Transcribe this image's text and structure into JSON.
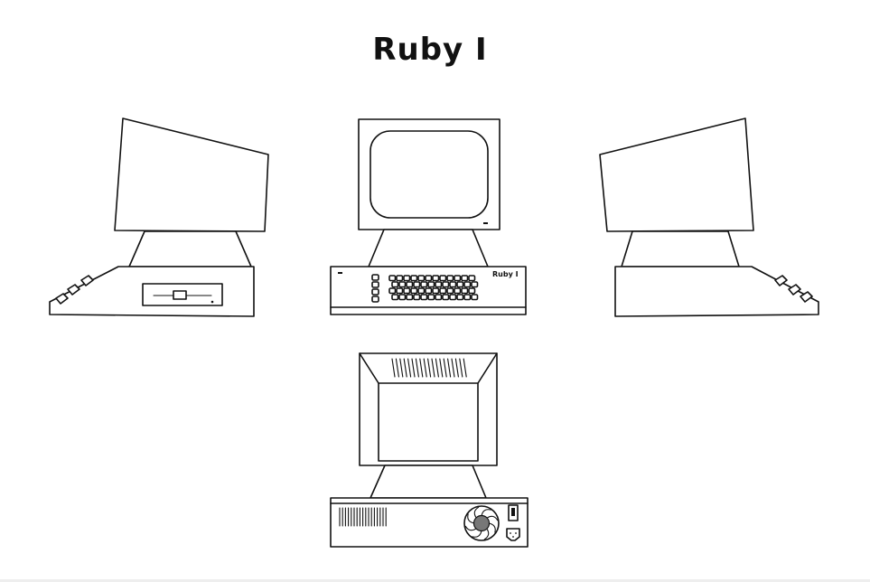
{
  "title": "Ruby I",
  "keyboard_brand": "Ruby I",
  "views": [
    {
      "name": "left-side-view"
    },
    {
      "name": "front-view"
    },
    {
      "name": "right-side-view"
    },
    {
      "name": "rear-view"
    }
  ],
  "colors": {
    "background": "#ffffff",
    "line": "#111111",
    "fan_hub": "#777777"
  }
}
